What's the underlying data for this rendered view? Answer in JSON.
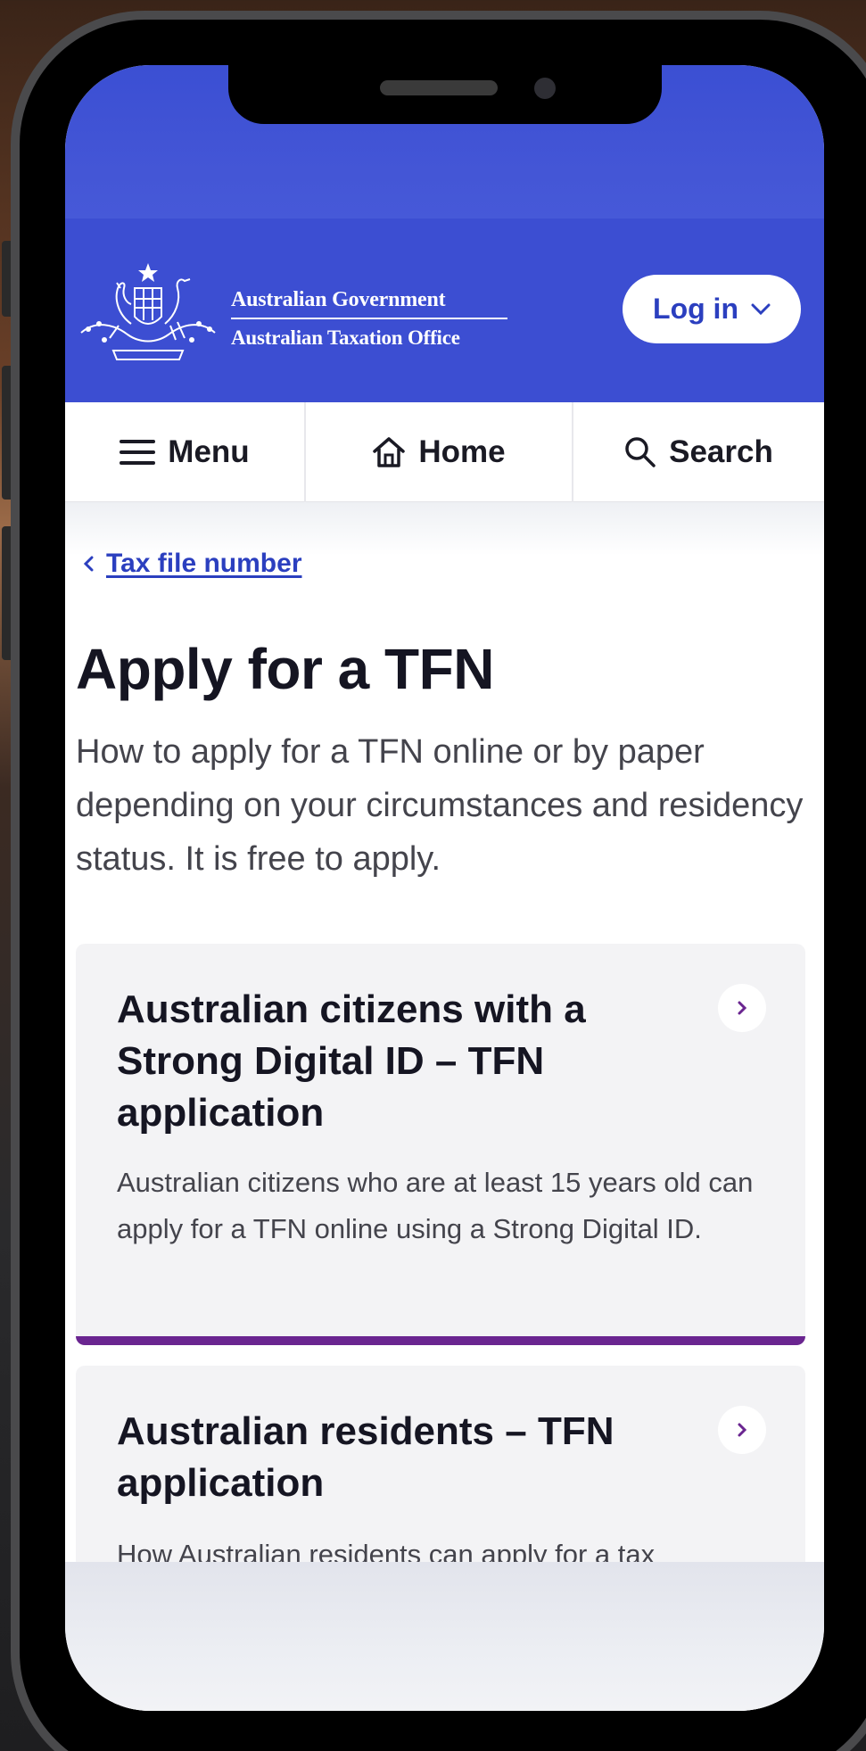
{
  "header": {
    "agency_line1": "Australian Government",
    "agency_line2": "Australian Taxation Office",
    "login_label": "Log in"
  },
  "nav": {
    "menu_label": "Menu",
    "home_label": "Home",
    "search_label": "Search"
  },
  "breadcrumb": {
    "label": "Tax file number"
  },
  "page": {
    "title": "Apply for a TFN",
    "intro": "How to apply for a TFN online or by paper depending on your circumstances and residency status. It is free to apply."
  },
  "cards": [
    {
      "title": "Australian citizens with a Strong Digital ID – TFN application",
      "description": "Australian citizens who are at least 15 years old can apply for a TFN online using a Strong Digital ID."
    },
    {
      "title": "Australian residents – TFN application",
      "description": "How Australian residents can apply for a tax"
    }
  ],
  "colors": {
    "brand_blue": "#3c4ed2",
    "link_blue": "#2b3fbf",
    "accent_purple": "#6a2590"
  }
}
